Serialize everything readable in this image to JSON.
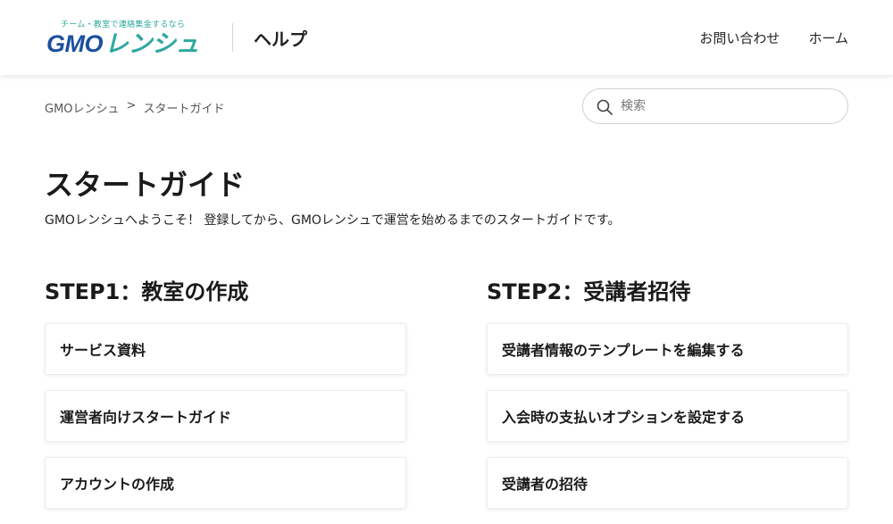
{
  "header": {
    "logo_tagline": "チーム・教室で連絡集金するなら",
    "logo_gmo": "GMO",
    "logo_rensyu": "レンシュ",
    "title": "ヘルプ",
    "nav": [
      "お問い合わせ",
      "ホーム"
    ]
  },
  "breadcrumb": {
    "home": "GMOレンシュ",
    "separator": ">",
    "current": "スタートガイド"
  },
  "search": {
    "placeholder": "検索"
  },
  "page": {
    "title": "スタートガイド",
    "description": "GMOレンシュへようこそ！ 登録してから、GMOレンシュで運営を始めるまでのスタートガイドです。"
  },
  "sections": [
    {
      "heading": "STEP1：教室の作成",
      "articles": [
        "サービス資料",
        "運営者向けスタートガイド",
        "アカウントの作成"
      ]
    },
    {
      "heading": "STEP2：受講者招待",
      "articles": [
        "受講者情報のテンプレートを編集する",
        "入会時の支払いオプションを設定する",
        "受講者の招待"
      ]
    }
  ],
  "colors": {
    "brand_blue": "#1b4fa0",
    "brand_teal": "#2ea8a0"
  }
}
